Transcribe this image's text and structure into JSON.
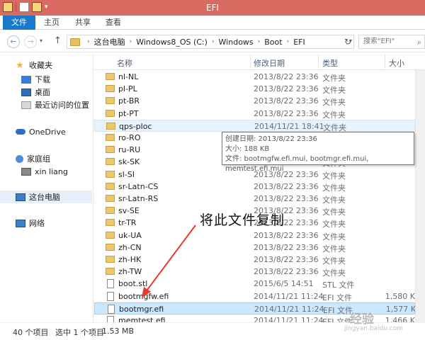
{
  "window": {
    "title": "EFI"
  },
  "ribbon": {
    "tabs": [
      "文件",
      "主页",
      "共享",
      "查看"
    ]
  },
  "address": {
    "crumbs": [
      "这台电脑",
      "Windows8_OS (C:)",
      "Windows",
      "Boot",
      "EFI"
    ],
    "search_placeholder": "搜索\"EFI\""
  },
  "nav_pane": {
    "favorites": "收藏夹",
    "downloads": "下载",
    "desktop": "桌面",
    "recent": "最近访问的位置",
    "onedrive": "OneDrive",
    "homegroup": "家庭组",
    "user": "xin liang",
    "this_pc": "这台电脑",
    "network": "网络"
  },
  "columns": {
    "name": "名称",
    "date": "修改日期",
    "type": "类型",
    "size": "大小"
  },
  "files": [
    {
      "name": "nl-NL",
      "date": "2013/8/22 23:36",
      "type": "文件夹",
      "size": "",
      "kind": "folder"
    },
    {
      "name": "pl-PL",
      "date": "2013/8/22 23:36",
      "type": "文件夹",
      "size": "",
      "kind": "folder"
    },
    {
      "name": "pt-BR",
      "date": "2013/8/22 23:36",
      "type": "文件夹",
      "size": "",
      "kind": "folder"
    },
    {
      "name": "pt-PT",
      "date": "2013/8/22 23:36",
      "type": "文件夹",
      "size": "",
      "kind": "folder"
    },
    {
      "name": "qps-ploc",
      "date": "2014/11/21 18:41",
      "type": "文件夹",
      "size": "",
      "kind": "folder"
    },
    {
      "name": "ro-RO",
      "date": "",
      "type": "",
      "size": "",
      "kind": "folder"
    },
    {
      "name": "ru-RU",
      "date": "",
      "type": "",
      "size": "",
      "kind": "folder"
    },
    {
      "name": "sk-SK",
      "date": "2013/8/22 23:36",
      "type": "文件夹",
      "size": "",
      "kind": "folder"
    },
    {
      "name": "sl-SI",
      "date": "2013/8/22 23:36",
      "type": "文件夹",
      "size": "",
      "kind": "folder"
    },
    {
      "name": "sr-Latn-CS",
      "date": "2013/8/22 23:36",
      "type": "文件夹",
      "size": "",
      "kind": "folder"
    },
    {
      "name": "sr-Latn-RS",
      "date": "2013/8/22 23:36",
      "type": "文件夹",
      "size": "",
      "kind": "folder"
    },
    {
      "name": "sv-SE",
      "date": "2013/8/22 23:36",
      "type": "文件夹",
      "size": "",
      "kind": "folder"
    },
    {
      "name": "tr-TR",
      "date": "2013/8/22 23:36",
      "type": "文件夹",
      "size": "",
      "kind": "folder"
    },
    {
      "name": "uk-UA",
      "date": "2013/8/22 23:36",
      "type": "文件夹",
      "size": "",
      "kind": "folder"
    },
    {
      "name": "zh-CN",
      "date": "2013/8/22 23:36",
      "type": "文件夹",
      "size": "",
      "kind": "folder"
    },
    {
      "name": "zh-HK",
      "date": "2013/8/22 23:36",
      "type": "文件夹",
      "size": "",
      "kind": "folder"
    },
    {
      "name": "zh-TW",
      "date": "2013/8/22 23:36",
      "type": "文件夹",
      "size": "",
      "kind": "folder"
    },
    {
      "name": "boot.stl",
      "date": "2015/6/5 14:51",
      "type": "STL 文件",
      "size": "",
      "kind": "file"
    },
    {
      "name": "bootmgfw.efi",
      "date": "2014/11/21 11:24",
      "type": "EFI 文件",
      "size": "1,580 K",
      "kind": "file"
    },
    {
      "name": "bootmgr.efi",
      "date": "2014/11/21 11:24",
      "type": "EFI 文件",
      "size": "1,577 K",
      "kind": "file"
    },
    {
      "name": "memtest.efi",
      "date": "2014/11/21 11:24",
      "type": "EFI 文件",
      "size": "1,466 K",
      "kind": "file"
    }
  ],
  "tooltip": {
    "created": "创建日期: 2013/8/22 23:36",
    "size": "大小: 188 KB",
    "files": "文件: bootmgfw.efi.mui, bootmgr.efi.mui, memtest.efi.mui"
  },
  "annotation": "将此文件复制",
  "status": {
    "count": "40 个项目",
    "selected": "选中 1 个项目",
    "size": "1.53 MB"
  },
  "watermark": {
    "main": "经验",
    "sub": "jingyan.baidu.com"
  },
  "colors": {
    "titlebar": "#d96a62",
    "file_tab": "#1979ca",
    "annotation_arrow": "#e83a2e"
  }
}
